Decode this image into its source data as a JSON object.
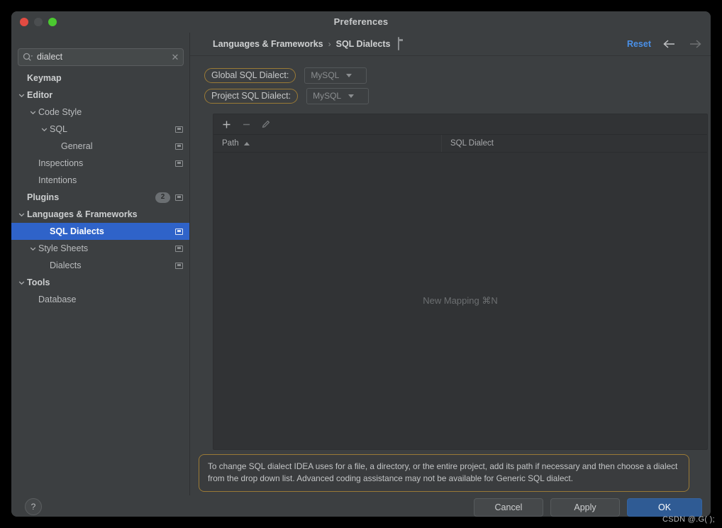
{
  "window": {
    "title": "Preferences",
    "traffic_lights": [
      "close-red",
      "minimize-disabled",
      "zoom-green"
    ]
  },
  "search": {
    "value": "dialect",
    "placeholder": "",
    "icon": "search-icon",
    "clear_icon": "close-icon"
  },
  "sidebar": {
    "items": [
      {
        "label": "Keymap",
        "indent": 0,
        "bold": true,
        "chevron": "none",
        "badge": "",
        "window_icon": false,
        "selected": false
      },
      {
        "label": "Editor",
        "indent": 0,
        "bold": true,
        "chevron": "down",
        "badge": "",
        "window_icon": false,
        "selected": false
      },
      {
        "label": "Code Style",
        "indent": 1,
        "bold": false,
        "chevron": "down",
        "badge": "",
        "window_icon": false,
        "selected": false
      },
      {
        "label": "SQL",
        "indent": 2,
        "bold": false,
        "chevron": "down",
        "badge": "",
        "window_icon": true,
        "selected": false
      },
      {
        "label": "General",
        "indent": 3,
        "bold": false,
        "chevron": "none",
        "badge": "",
        "window_icon": true,
        "selected": false
      },
      {
        "label": "Inspections",
        "indent": 1,
        "bold": false,
        "chevron": "none",
        "badge": "",
        "window_icon": true,
        "selected": false
      },
      {
        "label": "Intentions",
        "indent": 1,
        "bold": false,
        "chevron": "none",
        "badge": "",
        "window_icon": false,
        "selected": false
      },
      {
        "label": "Plugins",
        "indent": 0,
        "bold": true,
        "chevron": "none",
        "badge": "2",
        "window_icon": true,
        "selected": false
      },
      {
        "label": "Languages & Frameworks",
        "indent": 0,
        "bold": true,
        "chevron": "down",
        "badge": "",
        "window_icon": false,
        "selected": false
      },
      {
        "label": "SQL Dialects",
        "indent": 2,
        "bold": true,
        "chevron": "none",
        "badge": "",
        "window_icon": true,
        "selected": true
      },
      {
        "label": "Style Sheets",
        "indent": 1,
        "bold": false,
        "chevron": "down",
        "badge": "",
        "window_icon": true,
        "selected": false
      },
      {
        "label": "Dialects",
        "indent": 2,
        "bold": false,
        "chevron": "none",
        "badge": "",
        "window_icon": true,
        "selected": false
      },
      {
        "label": "Tools",
        "indent": 0,
        "bold": true,
        "chevron": "down",
        "badge": "",
        "window_icon": false,
        "selected": false
      },
      {
        "label": "Database",
        "indent": 1,
        "bold": false,
        "chevron": "none",
        "badge": "",
        "window_icon": false,
        "selected": false
      }
    ]
  },
  "header": {
    "breadcrumb": [
      "Languages & Frameworks",
      "SQL Dialects"
    ],
    "separator": "›",
    "page_icon": "window-icon",
    "reset_label": "Reset",
    "back_icon": "arrow-left-icon",
    "forward_icon": "arrow-right-icon"
  },
  "settings": {
    "global": {
      "label": "Global SQL Dialect:",
      "value": "MySQL"
    },
    "project": {
      "label": "Project SQL Dialect:",
      "value": "MySQL"
    },
    "highlight_color": "#9a7a36"
  },
  "table": {
    "toolbar": [
      {
        "name": "add-mapping-button",
        "glyph": "plus-icon",
        "enabled": true
      },
      {
        "name": "remove-mapping-button",
        "glyph": "minus-icon",
        "enabled": false
      },
      {
        "name": "edit-mapping-button",
        "glyph": "pencil-icon",
        "enabled": false
      }
    ],
    "columns": [
      "Path",
      "SQL Dialect"
    ],
    "sort_column": "Path",
    "sort_direction": "asc",
    "rows": [],
    "empty_text": "New Mapping ⌘N"
  },
  "banner": {
    "text": "To change SQL dialect IDEA uses for a file, a directory, or the entire project, add its path if necessary and then choose a dialect from the drop down list. Advanced coding assistance may not be available for Generic SQL dialect."
  },
  "footer": {
    "help_label": "?",
    "cancel_label": "Cancel",
    "apply_label": "Apply",
    "ok_label": "OK",
    "ok_color": "#2f5b94"
  },
  "watermark": {
    "text": "CSDN @.G( );"
  }
}
